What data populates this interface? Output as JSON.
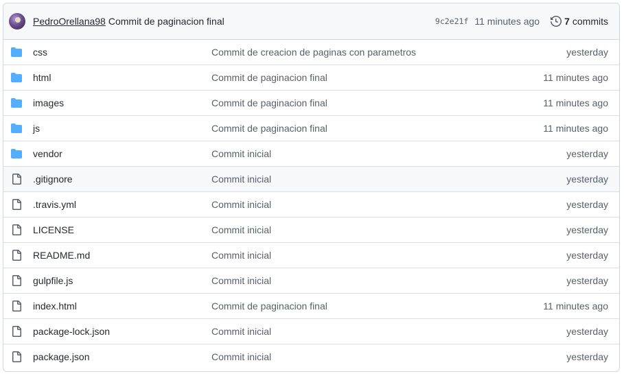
{
  "header": {
    "author": "PedroOrellana98",
    "message": "Commit de paginacion final",
    "sha": "9c2e21f",
    "time": "11 minutes ago",
    "commits_count": "7",
    "commits_label": "commits"
  },
  "colors": {
    "folder": "#54aeff",
    "file": "#57606a",
    "header_bg": "#f6f8fa",
    "border": "#d0d7de"
  },
  "files": [
    {
      "type": "folder",
      "icon": "folder-icon",
      "name": "css",
      "message": "Commit de creacion de paginas con parametros",
      "age": "yesterday"
    },
    {
      "type": "folder",
      "icon": "folder-icon",
      "name": "html",
      "message": "Commit de paginacion final",
      "age": "11 minutes ago"
    },
    {
      "type": "folder",
      "icon": "folder-icon",
      "name": "images",
      "message": "Commit de paginacion final",
      "age": "11 minutes ago"
    },
    {
      "type": "folder",
      "icon": "folder-icon",
      "name": "js",
      "message": "Commit de paginacion final",
      "age": "11 minutes ago"
    },
    {
      "type": "folder",
      "icon": "folder-icon",
      "name": "vendor",
      "message": "Commit inicial",
      "age": "yesterday"
    },
    {
      "type": "file",
      "icon": "file-icon",
      "name": ".gitignore",
      "message": "Commit inicial",
      "age": "yesterday"
    },
    {
      "type": "file",
      "icon": "file-icon",
      "name": ".travis.yml",
      "message": "Commit inicial",
      "age": "yesterday"
    },
    {
      "type": "file",
      "icon": "file-icon",
      "name": "LICENSE",
      "message": "Commit inicial",
      "age": "yesterday"
    },
    {
      "type": "file",
      "icon": "file-icon",
      "name": "README.md",
      "message": "Commit inicial",
      "age": "yesterday"
    },
    {
      "type": "file",
      "icon": "file-icon",
      "name": "gulpfile.js",
      "message": "Commit inicial",
      "age": "yesterday"
    },
    {
      "type": "file",
      "icon": "file-icon",
      "name": "index.html",
      "message": "Commit de paginacion final",
      "age": "11 minutes ago"
    },
    {
      "type": "file",
      "icon": "file-icon",
      "name": "package-lock.json",
      "message": "Commit inicial",
      "age": "yesterday"
    },
    {
      "type": "file",
      "icon": "file-icon",
      "name": "package.json",
      "message": "Commit inicial",
      "age": "yesterday"
    }
  ]
}
